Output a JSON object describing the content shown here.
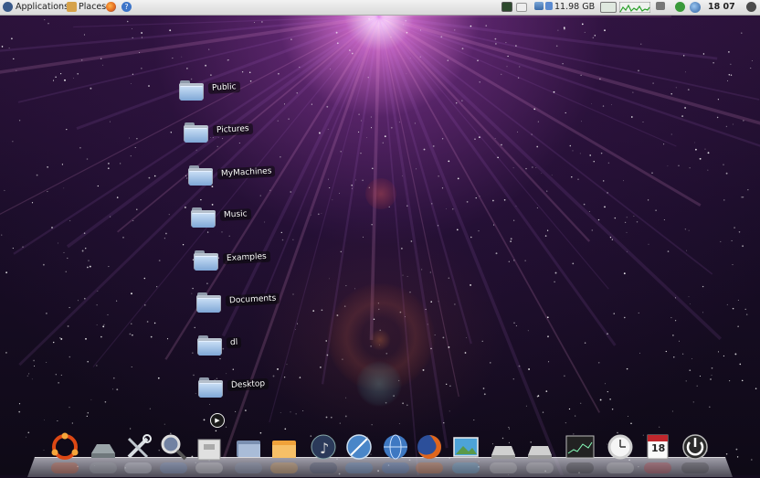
{
  "top_panel": {
    "applications_label": "Applications",
    "places_label": "Places",
    "disk_free": "11.98 GB",
    "clock": "18 07",
    "icons": [
      "ubuntu-menu-icon",
      "firefox-icon",
      "help-icon",
      "monitor-icon",
      "mail-icon",
      "network-icon",
      "cpu-graph-icon",
      "network-graph-icon",
      "battery-icon",
      "volume-icon",
      "globe-icon",
      "shutdown-icon"
    ]
  },
  "desktop": {
    "icons": [
      {
        "label": "Public",
        "type": "folder"
      },
      {
        "label": "Pictures",
        "type": "folder"
      },
      {
        "label": "MyMachines",
        "type": "folder"
      },
      {
        "label": "Music",
        "type": "folder"
      },
      {
        "label": "Examples",
        "type": "folder"
      },
      {
        "label": "Documents",
        "type": "folder"
      },
      {
        "label": "dl",
        "type": "folder"
      },
      {
        "label": "Desktop",
        "type": "folder"
      }
    ]
  },
  "dock": {
    "items": [
      {
        "icon": "ubuntu-logo-icon",
        "color": "#dd4814"
      },
      {
        "icon": "drive-icon",
        "color": "#9aa4a8"
      },
      {
        "icon": "tools-icon",
        "color": "#d8dde2"
      },
      {
        "icon": "search-icon",
        "color": "#6b8fc6"
      },
      {
        "icon": "trash-icon",
        "color": "#e0e0e0"
      },
      {
        "icon": "folder-icon",
        "color": "#7a8fb0"
      },
      {
        "icon": "home-folder-icon",
        "color": "#f0a23a"
      },
      {
        "icon": "music-player-icon",
        "color": "#2b3a5a"
      },
      {
        "icon": "browser-icon",
        "color": "#4a86c8"
      },
      {
        "icon": "globe-icon",
        "color": "#3e78c2"
      },
      {
        "icon": "firefox-icon",
        "color": "#e0661c"
      },
      {
        "icon": "image-viewer-icon",
        "color": "#4da3d8"
      },
      {
        "icon": "disk-drive-icon",
        "color": "#d0d0d0"
      },
      {
        "icon": "disk-drive-icon",
        "color": "#d0d0d0"
      },
      {
        "icon": "system-monitor-icon",
        "color": "#222"
      },
      {
        "icon": "clock-icon",
        "color": "#cfcfcf"
      },
      {
        "icon": "calendar-icon",
        "color": "#c0262c"
      },
      {
        "icon": "power-icon",
        "color": "#2a2a2a"
      }
    ],
    "calendar_day": "18",
    "play_indicator": "▶"
  }
}
